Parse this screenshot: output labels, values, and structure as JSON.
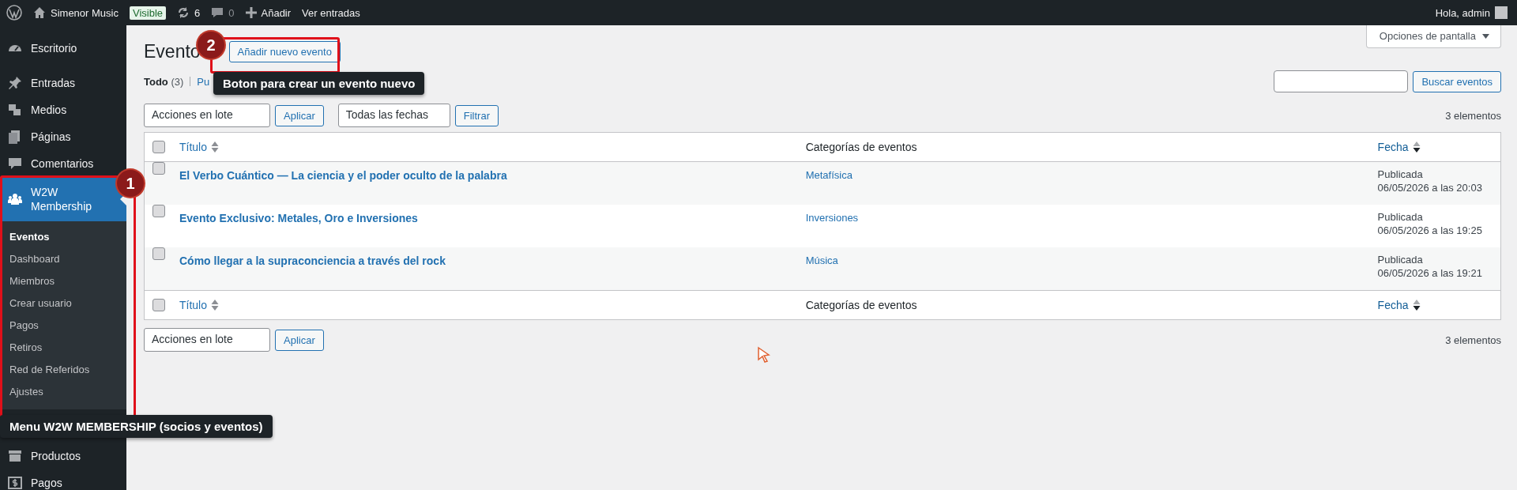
{
  "admin_bar": {
    "site_name": "Simenor Music",
    "badge": "Visible",
    "updates": "6",
    "comments": "0",
    "add": "Añadir",
    "view": "Ver entradas",
    "greeting": "Hola, admin"
  },
  "sidebar": {
    "items": [
      {
        "label": "Escritorio",
        "selected": false
      },
      {
        "label": "Entradas",
        "selected": false
      },
      {
        "label": "Medios",
        "selected": false
      },
      {
        "label": "Páginas",
        "selected": false
      },
      {
        "label": "Comentarios",
        "selected": false
      },
      {
        "label": "W2W Membership",
        "selected": true,
        "children": [
          {
            "label": "Eventos",
            "selected": true
          },
          {
            "label": "Dashboard",
            "selected": false
          },
          {
            "label": "Miembros",
            "selected": false
          },
          {
            "label": "Crear usuario",
            "selected": false
          },
          {
            "label": "Pagos",
            "selected": false
          },
          {
            "label": "Retiros",
            "selected": false
          },
          {
            "label": "Red de Referidos",
            "selected": false
          },
          {
            "label": "Ajustes",
            "selected": false
          }
        ]
      },
      {
        "label": "Productos",
        "selected": false
      },
      {
        "label": "Pagos",
        "selected": false
      }
    ]
  },
  "page": {
    "title": "Evento",
    "add_button": "Añadir nuevo evento",
    "screen_options": "Opciones de pantalla",
    "views": [
      {
        "label": "Todo",
        "count": "(3)",
        "selected": true
      },
      {
        "label": "Pu",
        "selected": false
      }
    ],
    "search_button": "Buscar eventos",
    "bulk_actions": "Acciones en lote",
    "apply": "Aplicar",
    "dates": "Todas las fechas",
    "filter": "Filtrar",
    "item_count": "3 elementos",
    "bottom_bulk_actions": "Acciones en lote",
    "bottom_apply": "Aplicar",
    "bottom_item_count": "3 elementos"
  },
  "table": {
    "select_all_checked": false,
    "footer_select_all_checked": false,
    "columns": [
      {
        "label": "Título",
        "sortable": true,
        "sorted": false
      },
      {
        "label": "Categorías de eventos",
        "sortable": false
      },
      {
        "label": "Fecha",
        "sortable": true,
        "sorted": true
      }
    ],
    "rows": [
      {
        "title": "El Verbo Cuántico — La ciencia y el poder oculto de la palabra",
        "category": "Metafísica",
        "status": "Publicada",
        "date": "06/05/2026 a las 20:03",
        "checked": false
      },
      {
        "title": "Evento Exclusivo: Metales, Oro e Inversiones",
        "category": "Inversiones",
        "status": "Publicada",
        "date": "06/05/2026 a las 19:25",
        "checked": false
      },
      {
        "title": "Cómo llegar a la supraconciencia a través del rock",
        "category": "Música",
        "status": "Publicada",
        "date": "06/05/2026 a las 19:21",
        "checked": false
      }
    ],
    "footer_columns": [
      {
        "label": "Título",
        "sortable": true,
        "sorted": false
      },
      {
        "label": "Categorías de eventos",
        "sortable": false
      },
      {
        "label": "Fecha",
        "sortable": true,
        "sorted": true
      }
    ]
  },
  "annotations": [
    {
      "number": "1",
      "text": "Menu W2W MEMBERSHIP (socios y eventos)"
    },
    {
      "number": "2",
      "text": "Boton para crear un evento nuevo"
    }
  ]
}
